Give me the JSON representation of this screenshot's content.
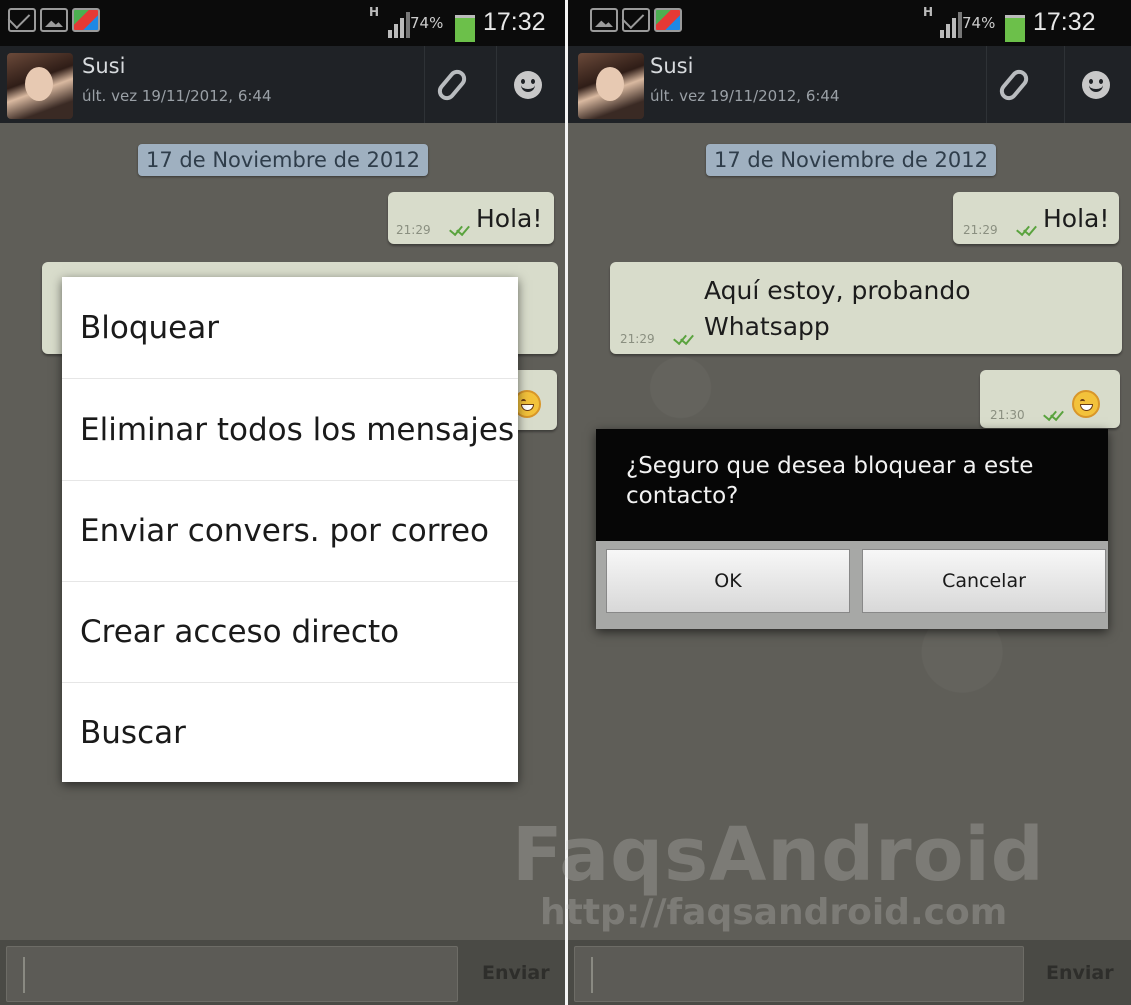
{
  "status_bar": {
    "network": "H",
    "battery_percent": "74%",
    "time": "17:32",
    "battery_color": "#6cc04a"
  },
  "header": {
    "contact_name": "Susi",
    "last_seen": "últ. vez 19/11/2012, 6:44",
    "attach_icon": "paperclip-icon",
    "emoji_icon": "smiley-icon"
  },
  "chat": {
    "date_separator": "17 de Noviembre de 2012",
    "messages": [
      {
        "time": "21:29",
        "text": "Hola!"
      },
      {
        "time": "21:29",
        "text_line1": "Aquí estoy, probando",
        "text_line2": "Whatsapp"
      },
      {
        "time": "21:30",
        "emoji": "smiley"
      }
    ]
  },
  "context_menu": {
    "items": [
      {
        "label": "Bloquear"
      },
      {
        "label": "Eliminar todos los mensajes"
      },
      {
        "label": "Enviar convers. por correo"
      },
      {
        "label": "Crear acceso directo"
      },
      {
        "label": "Buscar"
      }
    ]
  },
  "confirm_dialog": {
    "message": "¿Seguro que desea bloquear a este contacto?",
    "ok_label": "OK",
    "cancel_label": "Cancelar"
  },
  "composer": {
    "send_label": "Enviar",
    "input_value": ""
  },
  "watermark": {
    "brand": "FaqsAndroid",
    "url": "http://faqsandroid.com"
  },
  "colors": {
    "bubble": "#d8dccb",
    "date_chip": "#9fb0c0",
    "action_bar": "#1f2226",
    "read_ticks": "#5aa33e"
  }
}
